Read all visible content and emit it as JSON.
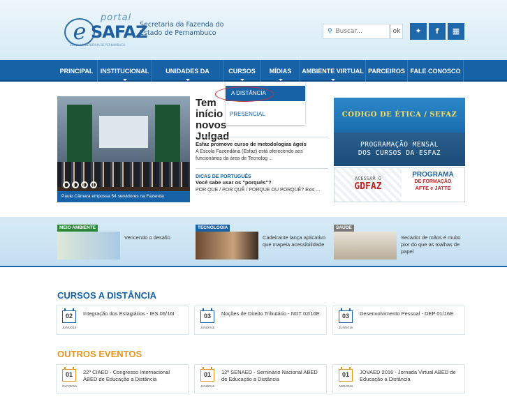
{
  "header": {
    "logo": {
      "portal": "portal",
      "e": "e",
      "safaz": "SAFAZ",
      "tagline": "ESCOLA FAZENDÁRIA DE PERNAMBUCO"
    },
    "org_line1": "Secretaria da Fazenda do",
    "org_line2": "Estado de Pernambuco",
    "search_placeholder": "Buscar...",
    "search_button": "ok",
    "social_icons": [
      "twitter-icon",
      "facebook-icon",
      "delicious-icon"
    ]
  },
  "nav": {
    "items": [
      "PRINCIPAL",
      "INSTITUCIONAL",
      "UNIDADES DA ESCOLA",
      "CURSOS",
      "MÍDIAS",
      "AMBIENTE VIRTUAL",
      "PARCEIROS",
      "FALE CONOSCO"
    ],
    "dropdown": {
      "active": "A DISTÂNCIA",
      "other": "PRESENCIAL"
    }
  },
  "hero": {
    "caption": "Paulo Câmara empossa 54 servidores na Fazenda",
    "title": "Tem início novos Julgad",
    "news": [
      {
        "headline": "Esfaz promove curso de metodologias ágeis",
        "text": "A Escola Fazendária (Esfaz) está oferecendo aos funcionários da área de Tecnolog ..."
      },
      {
        "category": "DICAS DE PORTUGUÊS",
        "headline": "Você sabe usar os \"porquês\"?",
        "text": "POR QUE / POR QUÊ / PORQUE OU PORQUÊ? Exis ..."
      }
    ]
  },
  "banners": {
    "etica": "CÓDIGO DE ÉTICA / SEFAZ",
    "programacao_line1": "PROGRAMAÇÃO MENSAL",
    "programacao_line2": "DOS CURSOS DA ESFAZ",
    "acesse": "ACESSAR O",
    "gdfaz": "GDFAZ",
    "programa": "PROGRAMA",
    "formacao": "DE FORMAÇÃO",
    "afte": "AFTE e JATTE"
  },
  "featured": [
    {
      "badge": "MEIO AMBIENTE",
      "text": "Vencendo o desafio",
      "color": "#2a8a3a"
    },
    {
      "badge": "TECNOLOGIA",
      "text": "Cadeirante lança aplicativo que mapeia acessibilidade",
      "color": "#1761a6"
    },
    {
      "badge": "SAÚDE",
      "text": "Secador de mãos é muito pior do que as toalhas de papel",
      "color": "#7a7a7a"
    }
  ],
  "cursos": {
    "title": "CURSOS A DISTÂNCIA",
    "items": [
      {
        "day": "02",
        "month": "JUN/2016",
        "text": "Integração dos Estagiários - IES 06/16I"
      },
      {
        "day": "03",
        "month": "JUN/2016",
        "text": "Noções de Direito Tributário - NDT 02/16E"
      },
      {
        "day": "03",
        "month": "JUN/2016",
        "text": "Desenvolvimento Pessoal - DEP 01/16E"
      }
    ]
  },
  "eventos": {
    "title": "OUTROS EVENTOS",
    "items": [
      {
        "day": "01",
        "month": "OUT/2016",
        "text": "22º CIAED - Congresso Internacional ABED de Educação a Distância"
      },
      {
        "day": "01",
        "month": "JUN/2016",
        "text": "12º SENAED - Seminário Nacional ABED de Educação a Distância"
      },
      {
        "day": "01",
        "month": "ABR/2016",
        "text": "JOVAED 2016 - Jornada Virtual ABED de Educação a Distância"
      }
    ]
  },
  "colors": {
    "primary": "#1761a6",
    "orange": "#e8951c",
    "red": "#c12020"
  }
}
